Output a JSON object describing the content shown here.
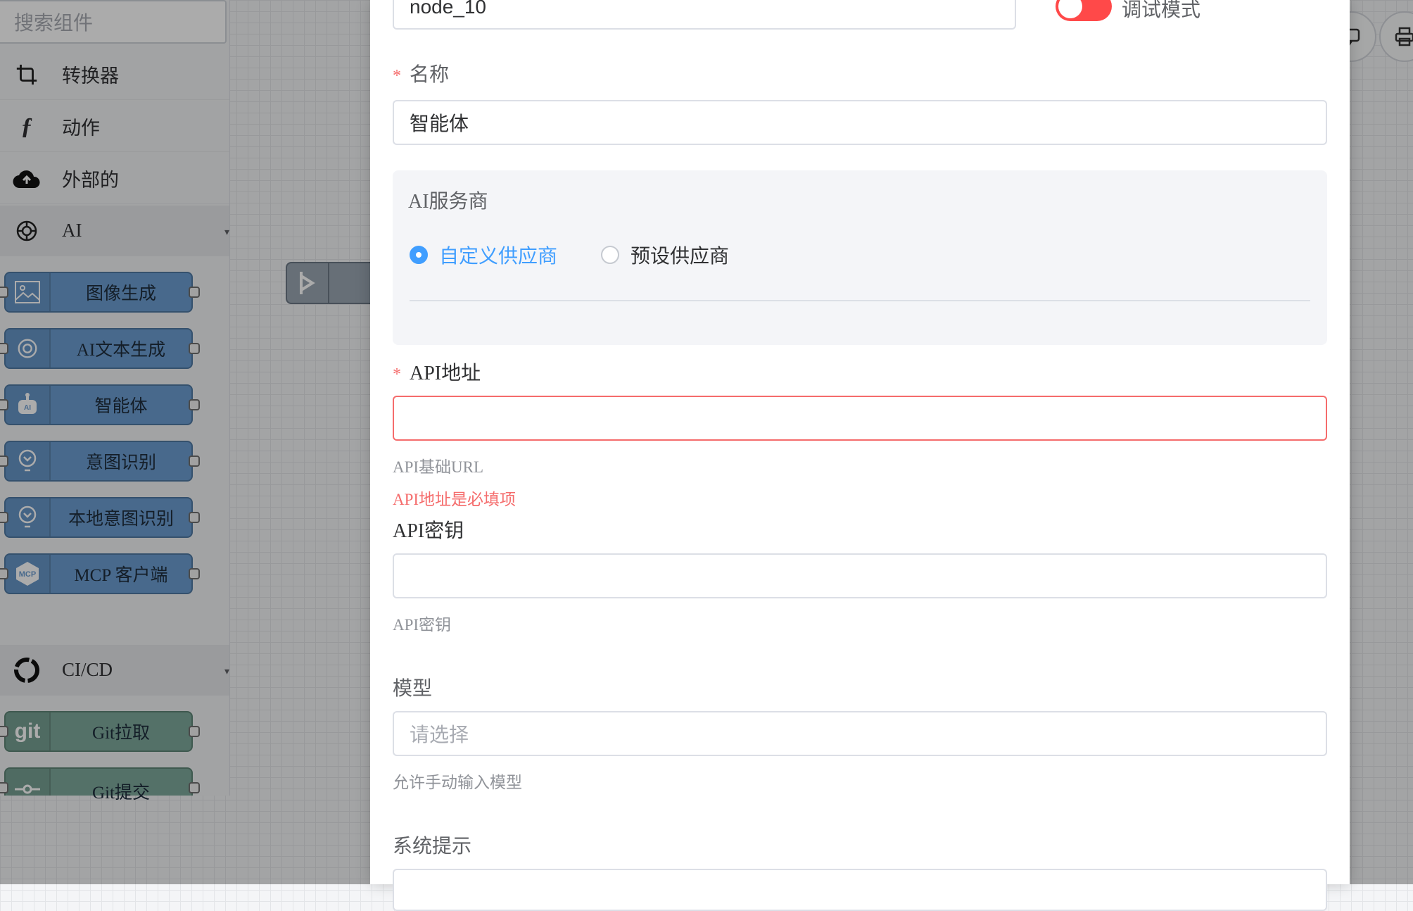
{
  "palette": {
    "search_placeholder": "搜索组件",
    "categories": [
      {
        "label": "转换器",
        "icon": "crop-icon"
      },
      {
        "label": "动作",
        "icon": "function-icon"
      },
      {
        "label": "外部的",
        "icon": "cloud-upload-icon"
      },
      {
        "label": "AI",
        "icon": "openai-icon"
      },
      {
        "label": "CI/CD",
        "icon": "ring-icon"
      }
    ],
    "ai_nodes": [
      {
        "label": "图像生成",
        "icon": "image-icon"
      },
      {
        "label": "AI文本生成",
        "icon": "openai-icon"
      },
      {
        "label": "智能体",
        "icon": "robot-icon"
      },
      {
        "label": "意图识别",
        "icon": "bulb-icon"
      },
      {
        "label": "本地意图识别",
        "icon": "bulb-icon"
      },
      {
        "label": "MCP 客户端",
        "icon": "mcp-icon"
      }
    ],
    "cicd_nodes": [
      {
        "label": "Git拉取",
        "icon": "git-icon"
      },
      {
        "label": "Git提交",
        "icon": "commit-icon"
      }
    ]
  },
  "drawer": {
    "node_id": "node_10",
    "debug_label": "调试模式",
    "debug_on": false,
    "name_label": "名称",
    "name_value": "智能体",
    "provider": {
      "label": "AI服务商",
      "options": [
        "自定义供应商",
        "预设供应商"
      ],
      "selected": "自定义供应商"
    },
    "api_url": {
      "label": "API地址",
      "value": "",
      "hint": "API基础URL",
      "error": "API地址是必填项"
    },
    "api_key": {
      "label": "API密钥",
      "value": "",
      "hint": "API密钥"
    },
    "model": {
      "label": "模型",
      "placeholder": "请选择",
      "hint": "允许手动输入模型"
    },
    "system_prompt": {
      "label": "系统提示"
    }
  },
  "colors": {
    "accent": "#409eff",
    "error": "#f56c6c",
    "toggle_off": "#ff4949"
  }
}
